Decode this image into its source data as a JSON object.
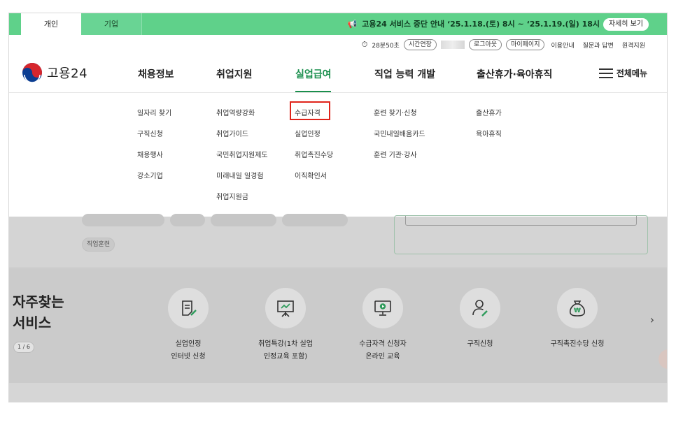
{
  "top_tabs": [
    {
      "label": "개인"
    },
    {
      "label": "기업"
    }
  ],
  "notice": {
    "text": "고용24 서비스 중단 안내 ‘25.1.18.(토) 8시 ~ ‘25.1.19.(일) 18시",
    "button": "자세히 보기"
  },
  "util": {
    "session_time": "28분50초",
    "extend": "시간연장",
    "logout": "로그아웃",
    "mypage": "마이페이지",
    "guide": "이용안내",
    "faq": "질문과 답변",
    "remote": "원격지원"
  },
  "logo": {
    "text": "고용24"
  },
  "gnb": [
    {
      "label": "채용정보"
    },
    {
      "label": "취업지원"
    },
    {
      "label": "실업급여"
    },
    {
      "label": "직업 능력 개발"
    },
    {
      "label": "출산휴가·육아휴직"
    }
  ],
  "all_menu": "전체메뉴",
  "submenu": {
    "col1": [
      "일자리 찾기",
      "구직신청",
      "채용행사",
      "강소기업"
    ],
    "col2": [
      "취업역량강화",
      "취업가이드",
      "국민취업지원제도",
      "미래내일 일경험",
      "취업지원금"
    ],
    "col3": [
      "수급자격",
      "실업인정",
      "취업촉진수당",
      "이직확인서"
    ],
    "col4": [
      "훈련 찾기·신청",
      "국민내일배움카드",
      "훈련 기관·강사"
    ],
    "col5": [
      "출산휴가",
      "육아휴직"
    ]
  },
  "chip": "직업훈련",
  "frequent": {
    "title_line1": "자주찾는",
    "title_line2": "서비스",
    "page": "1 / 6",
    "services": [
      {
        "line1": "실업인정",
        "line2": "인터넷 신청",
        "icon": "document-pen-icon"
      },
      {
        "line1": "취업특강(1차 실업",
        "line2": "인정교육 포함)",
        "icon": "presentation-board-icon"
      },
      {
        "line1": "수급자격 신청자",
        "line2": "온라인 교육",
        "icon": "monitor-play-icon"
      },
      {
        "line1": "구직신청",
        "line2": "",
        "icon": "user-pen-icon"
      },
      {
        "line1": "구직촉진수당 신청",
        "line2": "",
        "icon": "money-bag-icon"
      }
    ]
  },
  "colors": {
    "topbar": "#5fd18a",
    "active": "#1a8f4d",
    "highlight": "#e0241b"
  }
}
